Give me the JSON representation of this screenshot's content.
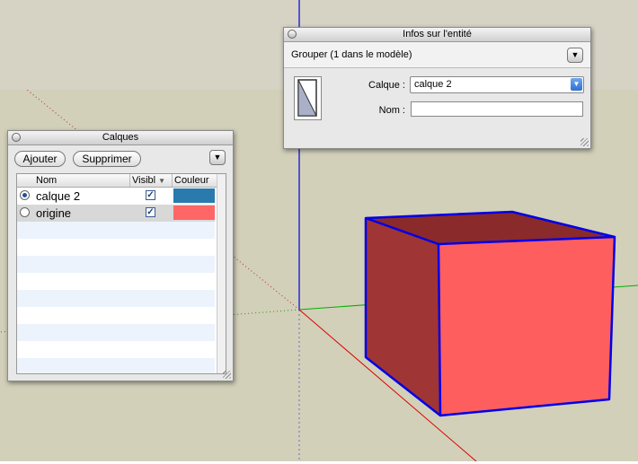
{
  "colors": {
    "sky": "#d6d3c4",
    "ground": "#d2d0b9",
    "cube_front": "#ff5e5e",
    "cube_side": "#a03535",
    "cube_top": "#8b2a2a",
    "edges": "#0000e8",
    "layer1_color": "#2a7aad",
    "layer2_color": "#ff6666"
  },
  "layers_panel": {
    "title": "Calques",
    "add_label": "Ajouter",
    "remove_label": "Supprimer",
    "menu_icon": "chevron-down-icon",
    "columns": {
      "name": "Nom",
      "visible": "Visibl",
      "color": "Couleur"
    },
    "rows": [
      {
        "name": "calque 2",
        "active": true,
        "visible": true,
        "color": "#2a7aad"
      },
      {
        "name": "origine",
        "active": false,
        "visible": true,
        "color": "#ff6666"
      }
    ]
  },
  "entity_panel": {
    "title": "Infos sur l'entité",
    "header": "Grouper (1 dans le modèle)",
    "layer_label": "Calque :",
    "layer_value": "calque 2",
    "name_label": "Nom :",
    "name_value": "",
    "thumbnail_icon": "group-icon",
    "menu_icon": "chevron-down-icon"
  }
}
